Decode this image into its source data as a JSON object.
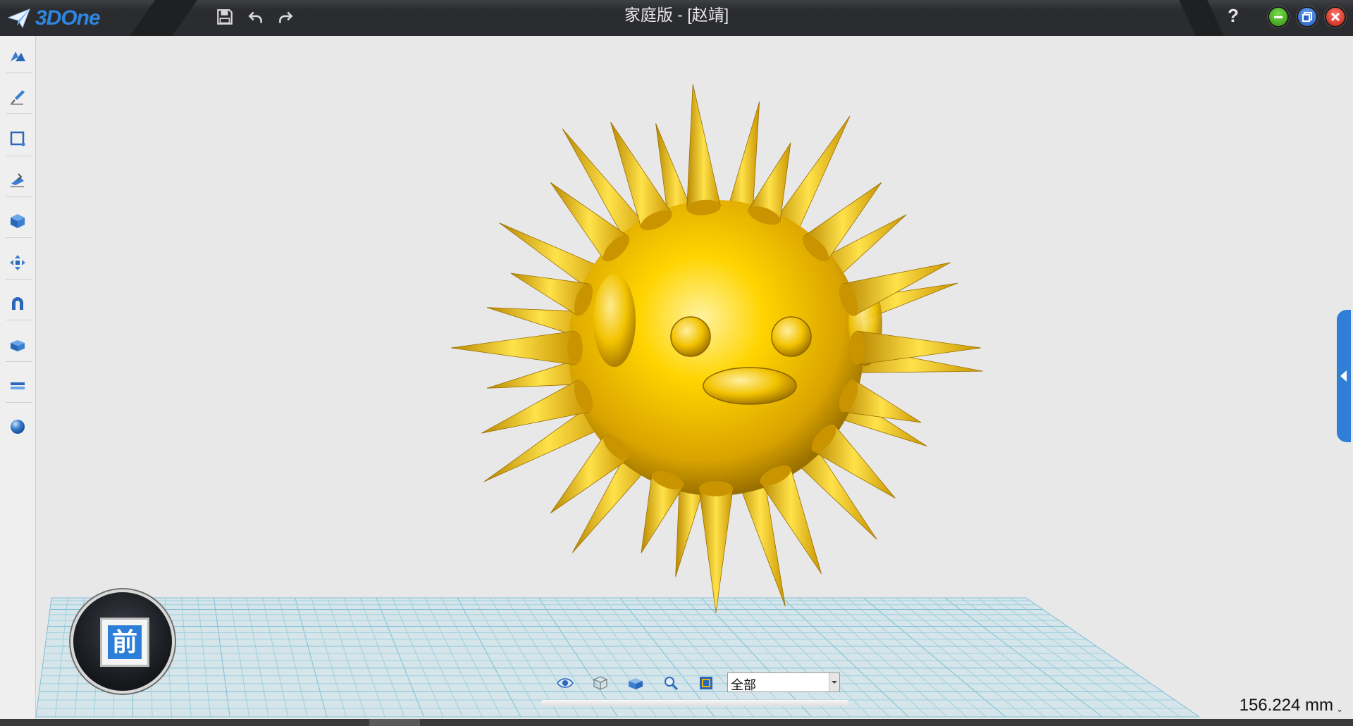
{
  "app": {
    "logo_text": "3DOne",
    "window_title": "家庭版 - [赵靖]",
    "help_label": "?"
  },
  "quick_access": [
    {
      "name": "save-icon"
    },
    {
      "name": "undo-icon"
    },
    {
      "name": "redo-icon"
    }
  ],
  "window_controls": {
    "minimize_color": "#3fae1e",
    "restore_color": "#2f6fd8",
    "close_color": "#e02b24"
  },
  "left_toolbar": [
    {
      "name": "basic-shapes-icon"
    },
    {
      "name": "sketch-icon"
    },
    {
      "name": "sketch-edit-icon"
    },
    {
      "name": "feature-modeling-icon"
    },
    {
      "name": "special-features-icon"
    },
    {
      "name": "basic-edit-icon"
    },
    {
      "name": "combine-icon"
    },
    {
      "name": "group-icon"
    },
    {
      "name": "measure-icon"
    },
    {
      "name": "material-render-icon"
    }
  ],
  "view_cube": {
    "face_label": "前"
  },
  "bottom_toolbar": {
    "icons": [
      "view-eye-icon",
      "wireframe-cube-icon",
      "shaded-cube-icon",
      "zoom-icon",
      "render-mode-icon"
    ],
    "filter": {
      "selected": "全部"
    }
  },
  "measure_display": "156.224 mm",
  "accent_color": "#2f7fd6",
  "model_color": "#f4c400"
}
